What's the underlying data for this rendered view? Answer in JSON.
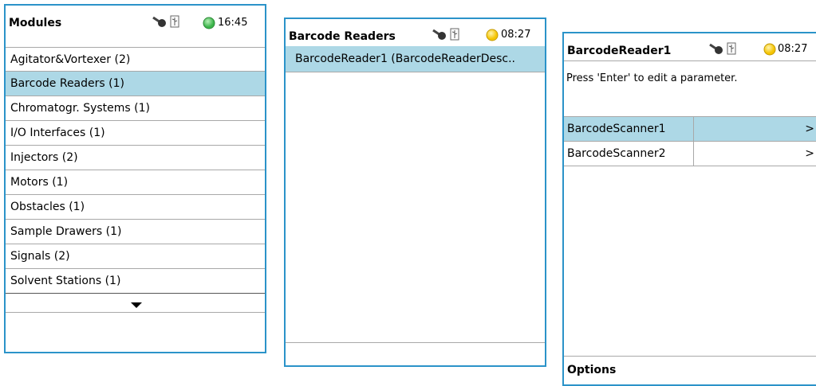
{
  "panel1": {
    "title": "Modules",
    "time": "16:45",
    "status": "green",
    "items": [
      "Agitator&Vortexer (2)",
      "Barcode Readers (1)",
      "Chromatogr. Systems (1)",
      "I/O Interfaces (1)",
      "Injectors (2)",
      "Motors (1)",
      "Obstacles (1)",
      "Sample Drawers (1)",
      "Signals (2)",
      "Solvent Stations (1)"
    ],
    "selected_index": 1
  },
  "panel2": {
    "title": "Barcode Readers",
    "time": "08:27",
    "status": "yellow",
    "items": [
      "BarcodeReader1 (BarcodeReaderDesc.."
    ]
  },
  "panel3": {
    "title": "BarcodeReader1",
    "time": "08:27",
    "status": "yellow",
    "instruction": "Press 'Enter' to edit a parameter.",
    "rows": [
      {
        "name": "BarcodeScanner1",
        "value": ">"
      },
      {
        "name": "BarcodeScanner2",
        "value": ">"
      }
    ],
    "footer": "Options"
  },
  "colors": {
    "border": "#2b93c9",
    "selection": "#add8e6",
    "led_green": "#3cb44b",
    "led_yellow": "#f5c400"
  },
  "icons": [
    "key-icon",
    "usb-icon",
    "status-led-icon",
    "scroll-down-arrow-icon"
  ]
}
